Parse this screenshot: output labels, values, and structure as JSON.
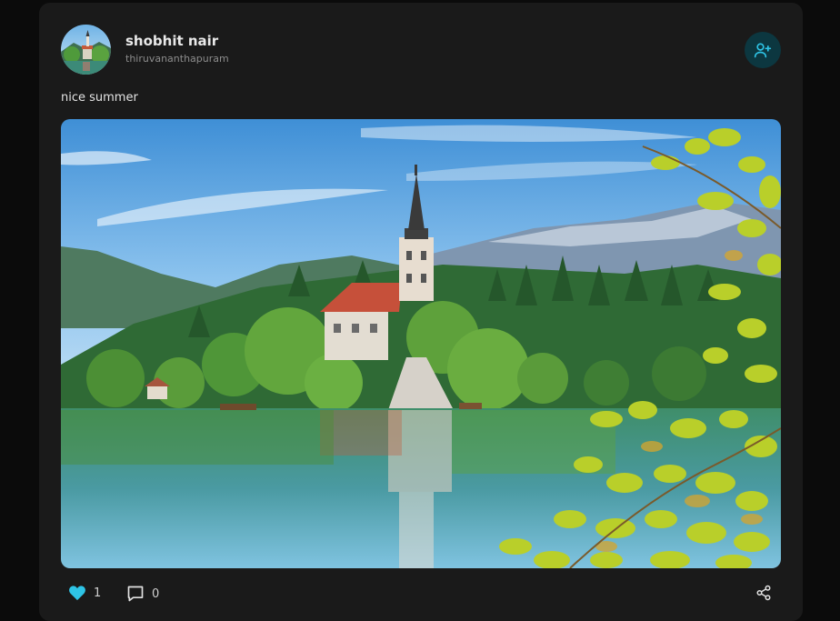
{
  "post": {
    "user_name": "shobhit nair",
    "location": "thiruvananthapuram",
    "caption": "nice summer",
    "likes": "1",
    "comments": "0"
  },
  "icons": {
    "follow": "user-plus-icon",
    "like": "heart-icon",
    "comment": "comment-icon",
    "share": "share-icon"
  },
  "colors": {
    "card_bg": "#1a1a1a",
    "page_bg": "#0b0b0b",
    "accent": "#2ec4e6",
    "follow_btn_bg": "#0c3740"
  }
}
